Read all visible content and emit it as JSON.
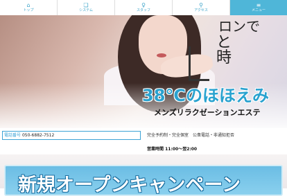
{
  "nav": {
    "items": [
      {
        "label": "トップ",
        "icon": "home-icon",
        "glyph": "⌂"
      },
      {
        "label": "システム",
        "icon": "system-icon",
        "glyph": "❏"
      },
      {
        "label": "スタッフ",
        "icon": "staff-icon",
        "glyph": "♀"
      },
      {
        "label": "アクセス",
        "icon": "map-pin-icon",
        "glyph": "⚲"
      },
      {
        "label": "メニュー",
        "icon": "menu-icon",
        "glyph": "≡"
      }
    ],
    "active_index": 4,
    "accent_color": "#4fb6d8"
  },
  "hero": {
    "tagline_line1": "ロンで",
    "tagline_line2": "と",
    "tagline_line3": "時",
    "brand_name": "38°Cのほほえみ",
    "subtitle": "メンズリラクゼーションエステ",
    "brand_color": "#2aa2cf"
  },
  "info": {
    "phone_label": "電話番号",
    "phone_number": "050-6882-7512",
    "features": "完全予約制・完全個室　公衆電話・非通知拒否",
    "hours": "営業時間 11:00～翌2:00"
  },
  "banner": {
    "text": "新規オープンキャンペーン"
  }
}
